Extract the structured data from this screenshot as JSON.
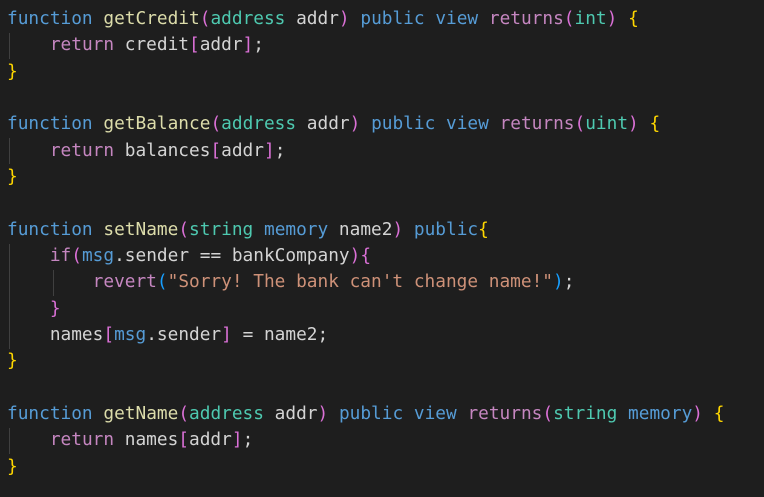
{
  "code": {
    "lines": [
      [
        {
          "text": "function",
          "cls": "kw-blue"
        },
        {
          "text": " ",
          "cls": "plain"
        },
        {
          "text": "getCredit",
          "cls": "fn"
        },
        {
          "text": "(",
          "cls": "br2"
        },
        {
          "text": "address",
          "cls": "type"
        },
        {
          "text": " addr",
          "cls": "plain"
        },
        {
          "text": ")",
          "cls": "br2"
        },
        {
          "text": " ",
          "cls": "plain"
        },
        {
          "text": "public",
          "cls": "kw-blue"
        },
        {
          "text": " ",
          "cls": "plain"
        },
        {
          "text": "view",
          "cls": "kw-blue"
        },
        {
          "text": " ",
          "cls": "plain"
        },
        {
          "text": "returns",
          "cls": "kw-purple"
        },
        {
          "text": "(",
          "cls": "br2"
        },
        {
          "text": "int",
          "cls": "type"
        },
        {
          "text": ")",
          "cls": "br2"
        },
        {
          "text": " ",
          "cls": "plain"
        },
        {
          "text": "{",
          "cls": "br1"
        }
      ],
      [
        {
          "text": "    ",
          "cls": "plain"
        },
        {
          "text": "return",
          "cls": "kw-purple"
        },
        {
          "text": " credit",
          "cls": "plain"
        },
        {
          "text": "[",
          "cls": "br2"
        },
        {
          "text": "addr",
          "cls": "plain"
        },
        {
          "text": "]",
          "cls": "br2"
        },
        {
          "text": ";",
          "cls": "plain"
        }
      ],
      [
        {
          "text": "}",
          "cls": "br1"
        }
      ],
      [],
      [
        {
          "text": "function",
          "cls": "kw-blue"
        },
        {
          "text": " ",
          "cls": "plain"
        },
        {
          "text": "getBalance",
          "cls": "fn"
        },
        {
          "text": "(",
          "cls": "br2"
        },
        {
          "text": "address",
          "cls": "type"
        },
        {
          "text": " addr",
          "cls": "plain"
        },
        {
          "text": ")",
          "cls": "br2"
        },
        {
          "text": " ",
          "cls": "plain"
        },
        {
          "text": "public",
          "cls": "kw-blue"
        },
        {
          "text": " ",
          "cls": "plain"
        },
        {
          "text": "view",
          "cls": "kw-blue"
        },
        {
          "text": " ",
          "cls": "plain"
        },
        {
          "text": "returns",
          "cls": "kw-purple"
        },
        {
          "text": "(",
          "cls": "br2"
        },
        {
          "text": "uint",
          "cls": "type"
        },
        {
          "text": ")",
          "cls": "br2"
        },
        {
          "text": " ",
          "cls": "plain"
        },
        {
          "text": "{",
          "cls": "br1"
        }
      ],
      [
        {
          "text": "    ",
          "cls": "plain"
        },
        {
          "text": "return",
          "cls": "kw-purple"
        },
        {
          "text": " balances",
          "cls": "plain"
        },
        {
          "text": "[",
          "cls": "br2"
        },
        {
          "text": "addr",
          "cls": "plain"
        },
        {
          "text": "]",
          "cls": "br2"
        },
        {
          "text": ";",
          "cls": "plain"
        }
      ],
      [
        {
          "text": "}",
          "cls": "br1"
        }
      ],
      [],
      [
        {
          "text": "function",
          "cls": "kw-blue"
        },
        {
          "text": " ",
          "cls": "plain"
        },
        {
          "text": "setName",
          "cls": "fn"
        },
        {
          "text": "(",
          "cls": "br2"
        },
        {
          "text": "string",
          "cls": "type"
        },
        {
          "text": " ",
          "cls": "plain"
        },
        {
          "text": "memory",
          "cls": "kw-blue"
        },
        {
          "text": " name2",
          "cls": "plain"
        },
        {
          "text": ")",
          "cls": "br2"
        },
        {
          "text": " ",
          "cls": "plain"
        },
        {
          "text": "public",
          "cls": "kw-blue"
        },
        {
          "text": "{",
          "cls": "br1"
        }
      ],
      [
        {
          "text": "    ",
          "cls": "plain"
        },
        {
          "text": "if",
          "cls": "kw-purple"
        },
        {
          "text": "(",
          "cls": "br2"
        },
        {
          "text": "msg",
          "cls": "kw-blue"
        },
        {
          "text": ".sender == bankCompany",
          "cls": "plain"
        },
        {
          "text": ")",
          "cls": "br2"
        },
        {
          "text": "{",
          "cls": "br2"
        }
      ],
      [
        {
          "text": "        ",
          "cls": "plain"
        },
        {
          "text": "revert",
          "cls": "kw-purple"
        },
        {
          "text": "(",
          "cls": "br3"
        },
        {
          "text": "\"Sorry! The bank can't change name!\"",
          "cls": "str"
        },
        {
          "text": ")",
          "cls": "br3"
        },
        {
          "text": ";",
          "cls": "plain"
        }
      ],
      [
        {
          "text": "    ",
          "cls": "plain"
        },
        {
          "text": "}",
          "cls": "br2"
        }
      ],
      [
        {
          "text": "    names",
          "cls": "plain"
        },
        {
          "text": "[",
          "cls": "br2"
        },
        {
          "text": "msg",
          "cls": "kw-blue"
        },
        {
          "text": ".sender",
          "cls": "plain"
        },
        {
          "text": "]",
          "cls": "br2"
        },
        {
          "text": " = name2;",
          "cls": "plain"
        }
      ],
      [
        {
          "text": "}",
          "cls": "br1"
        }
      ],
      [],
      [
        {
          "text": "function",
          "cls": "kw-blue"
        },
        {
          "text": " ",
          "cls": "plain"
        },
        {
          "text": "getName",
          "cls": "fn"
        },
        {
          "text": "(",
          "cls": "br2"
        },
        {
          "text": "address",
          "cls": "type"
        },
        {
          "text": " addr",
          "cls": "plain"
        },
        {
          "text": ")",
          "cls": "br2"
        },
        {
          "text": " ",
          "cls": "plain"
        },
        {
          "text": "public",
          "cls": "kw-blue"
        },
        {
          "text": " ",
          "cls": "plain"
        },
        {
          "text": "view",
          "cls": "kw-blue"
        },
        {
          "text": " ",
          "cls": "plain"
        },
        {
          "text": "returns",
          "cls": "kw-purple"
        },
        {
          "text": "(",
          "cls": "br2"
        },
        {
          "text": "string",
          "cls": "type"
        },
        {
          "text": " ",
          "cls": "plain"
        },
        {
          "text": "memory",
          "cls": "kw-blue"
        },
        {
          "text": ")",
          "cls": "br2"
        },
        {
          "text": " ",
          "cls": "plain"
        },
        {
          "text": "{",
          "cls": "br1"
        }
      ],
      [
        {
          "text": "    ",
          "cls": "plain"
        },
        {
          "text": "return",
          "cls": "kw-purple"
        },
        {
          "text": " names",
          "cls": "plain"
        },
        {
          "text": "[",
          "cls": "br2"
        },
        {
          "text": "addr",
          "cls": "plain"
        },
        {
          "text": "]",
          "cls": "br2"
        },
        {
          "text": ";",
          "cls": "plain"
        }
      ],
      [
        {
          "text": "}",
          "cls": "br1"
        }
      ]
    ]
  },
  "colors": {
    "background": "#1e1e1e",
    "keyword_blue": "#569cd6",
    "keyword_purple": "#c586c0",
    "function_name": "#dcdcaa",
    "type": "#4ec9b0",
    "string": "#ce9178",
    "bracket_gold": "#ffd700",
    "bracket_orchid": "#da70d6",
    "bracket_blue": "#179fff"
  }
}
